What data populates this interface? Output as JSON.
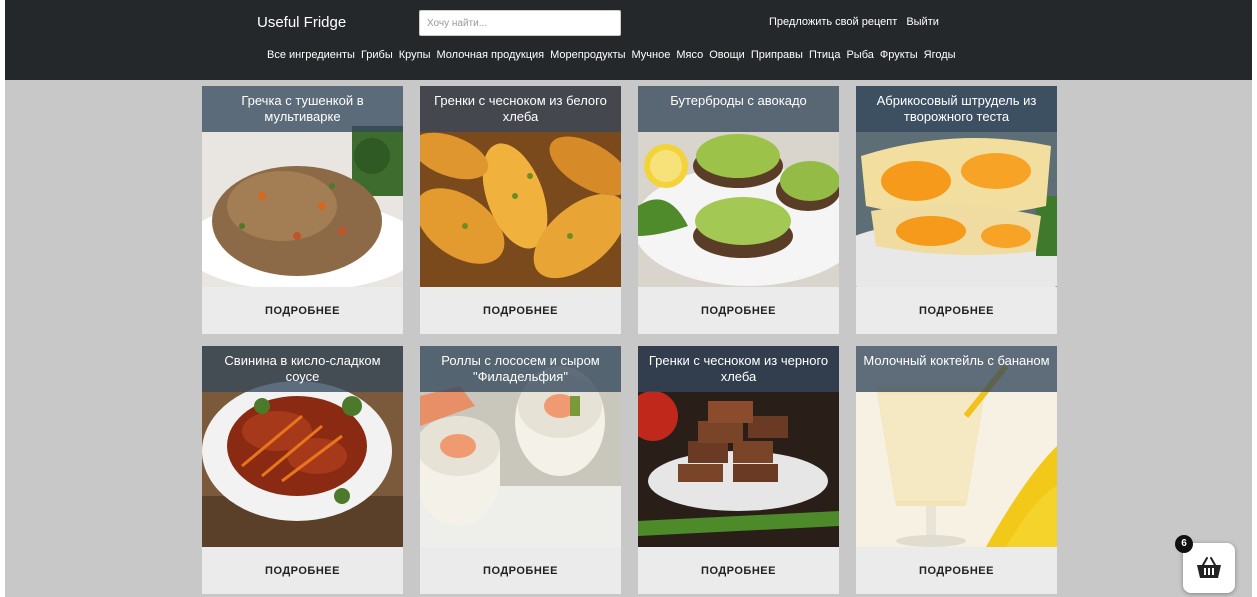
{
  "header": {
    "brand": "Useful Fridge",
    "search_placeholder": "Хочу найти...",
    "links": [
      "Предложить свой рецепт",
      "Выйти"
    ],
    "categories": [
      "Все ингредиенты",
      "Грибы",
      "Крупы",
      "Молочная продукция",
      "Морепродукты",
      "Мучное",
      "Мясо",
      "Овощи",
      "Приправы",
      "Птица",
      "Рыба",
      "Фрукты",
      "Ягоды"
    ]
  },
  "recipes": [
    {
      "title": "Гречка с тушенкой в мультиварке",
      "button": "ПОДРОБНЕЕ",
      "image": "buckwheat-with-meat"
    },
    {
      "title": "Гренки с чесноком из белого хлеба",
      "button": "ПОДРОБНЕЕ",
      "image": "garlic-toast-white"
    },
    {
      "title": "Бутерброды с авокадо",
      "button": "ПОДРОБНЕЕ",
      "image": "avocado-sandwiches"
    },
    {
      "title": "Абрикосовый штрудель из творожного теста",
      "button": "ПОДРОБНЕЕ",
      "image": "apricot-strudel"
    },
    {
      "title": "Свинина в кисло-сладком соусе",
      "button": "ПОДРОБНЕЕ",
      "image": "sweet-sour-pork"
    },
    {
      "title": "Роллы с лососем и сыром \"Филадельфия\"",
      "button": "ПОДРОБНЕЕ",
      "image": "philadelphia-rolls"
    },
    {
      "title": "Гренки с чесноком из черного хлеба",
      "button": "ПОДРОБНЕЕ",
      "image": "garlic-toast-black"
    },
    {
      "title": "Молочный коктейль с бананом",
      "button": "ПОДРОБНЕЕ",
      "image": "banana-milkshake"
    }
  ],
  "cart": {
    "count": "6",
    "icon": "basket-icon"
  },
  "colors": {
    "header_bg": "#25282b",
    "page_bg": "#c8c8c8",
    "card_bg": "#ebebeb",
    "title_overlay": "#34485c"
  }
}
